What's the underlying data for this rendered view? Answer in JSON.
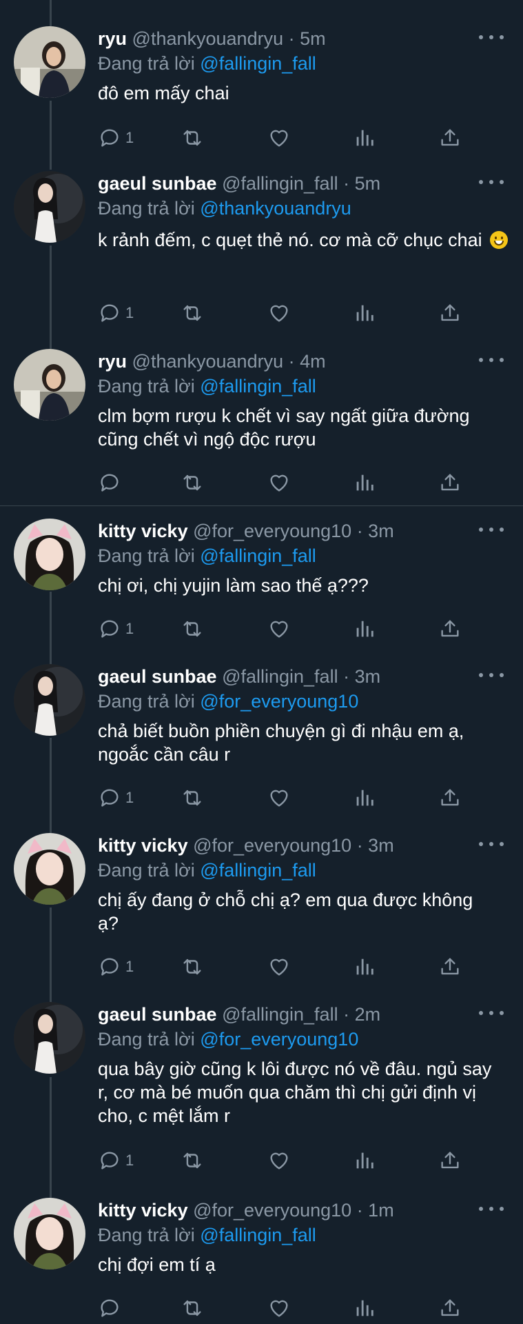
{
  "colors": {
    "background": "#15202b",
    "secondary_text": "#8b98a5",
    "mention": "#1d9bf0",
    "thread_line": "#38444d"
  },
  "reply_prefix": "Đang trả lời",
  "tweets": [
    {
      "name": "ryu",
      "handle": "@thankyouandryu",
      "time": "· 5m",
      "reply_to": "@fallingin_fall",
      "text": "đô em mấy chai",
      "reply_count": "1",
      "avatar": "ryu-avatar"
    },
    {
      "name": "gaeul sunbae",
      "handle": "@fallingin_fall",
      "time": "· 5m",
      "reply_to": "@thankyouandryu",
      "text": "k rảnh đếm, c quẹt thẻ nó. cơ mà cỡ chục chai",
      "emoji": "grinning-face-emoji",
      "reply_count": "1",
      "avatar": "gaeul-avatar"
    },
    {
      "name": "ryu",
      "handle": "@thankyouandryu",
      "time": "· 4m",
      "reply_to": "@fallingin_fall",
      "text": "clm bợm rượu k chết vì say ngất giữa đường cũng chết vì ngộ độc rượu",
      "reply_count": "",
      "avatar": "ryu-avatar"
    },
    {
      "name": "kitty vicky",
      "handle": "@for_everyoung10",
      "time": "· 3m",
      "reply_to": "@fallingin_fall",
      "text": "chị ơi, chị yujin làm sao thế ạ???",
      "reply_count": "1",
      "avatar": "kitty-avatar"
    },
    {
      "name": "gaeul sunbae",
      "handle": "@fallingin_fall",
      "time": "· 3m",
      "reply_to": "@for_everyoung10",
      "text": "chả biết buồn phiền chuyện gì đi nhậu em ạ, ngoắc cần câu r",
      "reply_count": "1",
      "avatar": "gaeul-avatar"
    },
    {
      "name": "kitty vicky",
      "handle": "@for_everyoung10",
      "time": "· 3m",
      "reply_to": "@fallingin_fall",
      "text": "chị ấy đang ở chỗ chị ạ? em qua được không ạ?",
      "reply_count": "1",
      "avatar": "kitty-avatar"
    },
    {
      "name": "gaeul sunbae",
      "handle": "@fallingin_fall",
      "time": "· 2m",
      "reply_to": "@for_everyoung10",
      "text": "qua bây giờ cũng k lôi được nó về đâu. ngủ say r, cơ mà bé muốn qua chăm thì chị gửi định vị cho, c mệt lắm r",
      "reply_count": "1",
      "avatar": "gaeul-avatar"
    },
    {
      "name": "kitty vicky",
      "handle": "@for_everyoung10",
      "time": "· 1m",
      "reply_to": "@fallingin_fall",
      "text": "chị đợi em tí ạ",
      "reply_count": "",
      "avatar": "kitty-avatar"
    }
  ],
  "icons": {
    "more": "more-options-icon",
    "reply": "reply-icon",
    "retweet": "retweet-icon",
    "like": "heart-icon",
    "views": "views-icon",
    "share": "share-icon"
  }
}
